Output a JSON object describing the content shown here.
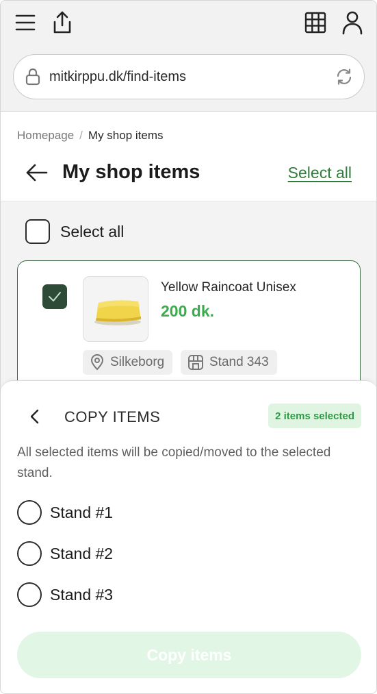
{
  "browser": {
    "url": "mitkirppu.dk/find-items",
    "icons": [
      "menu-icon",
      "share-icon",
      "grid-icon",
      "user-icon",
      "lock-icon",
      "refresh-icon"
    ]
  },
  "breadcrumb": {
    "home": "Homepage",
    "separator": "/",
    "current": "My shop items"
  },
  "header": {
    "title": "My shop items",
    "select_all_link": "Select all"
  },
  "list": {
    "select_all_label": "Select all",
    "items": [
      {
        "name": "Yellow Raincoat Unisex",
        "price": "200 dk.",
        "location": "Silkeborg",
        "stand": "Stand 343",
        "checked": true
      }
    ]
  },
  "sheet": {
    "title": "COPY ITEMS",
    "badge": "2 items selected",
    "description": "All selected items will be copied/moved to the selected stand.",
    "options": [
      "Stand #1",
      "Stand #2",
      "Stand #3"
    ],
    "button_label": "Copy items"
  },
  "colors": {
    "accent_green": "#3bab4c",
    "link_green": "#2f7d3a",
    "dark_check": "#2d4b36",
    "badge_bg": "#dff5e2",
    "button_disabled_bg": "#e2f6e6"
  }
}
